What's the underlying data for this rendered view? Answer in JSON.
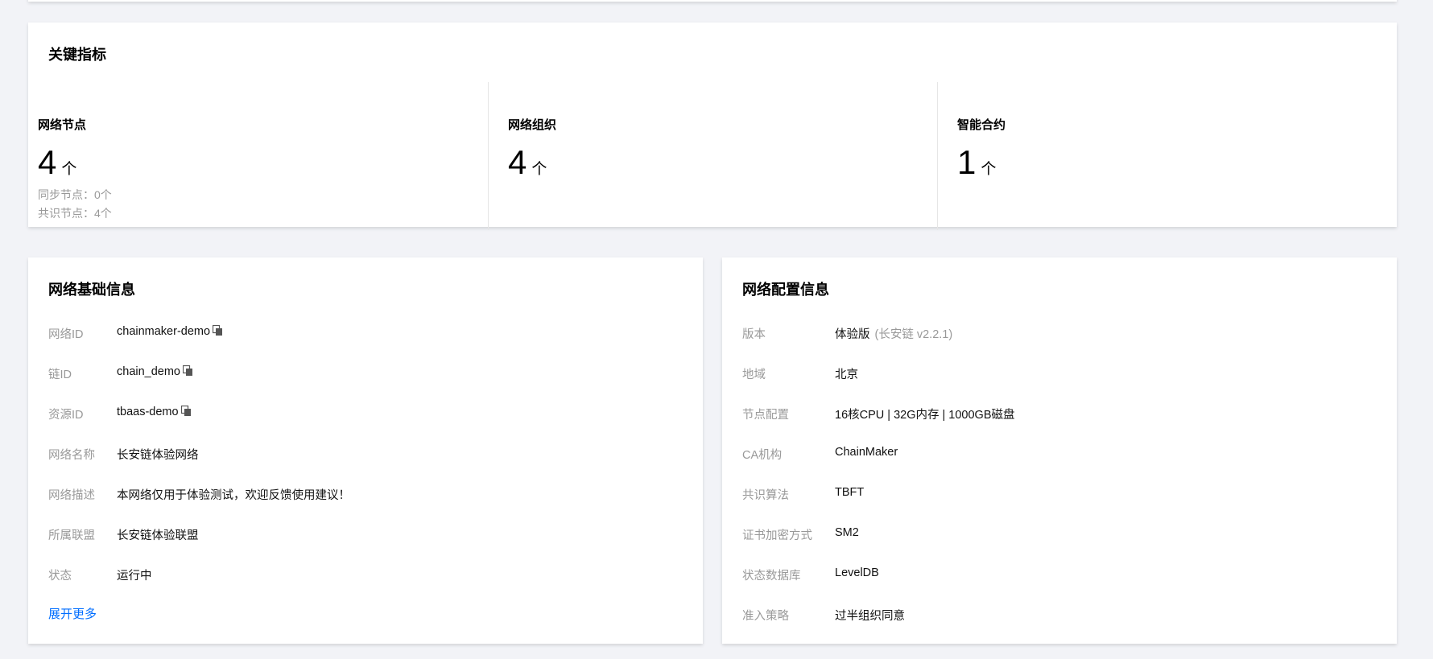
{
  "metrics": {
    "title": "关键指标",
    "items": [
      {
        "label": "网络节点",
        "value": "4",
        "unit": "个",
        "sub": [
          "同步节点：0个",
          "共识节点：4个"
        ]
      },
      {
        "label": "网络组织",
        "value": "4",
        "unit": "个"
      },
      {
        "label": "智能合约",
        "value": "1",
        "unit": "个"
      }
    ]
  },
  "basic": {
    "title": "网络基础信息",
    "rows": [
      {
        "key": "网络ID",
        "value": "chainmaker-demo"
      },
      {
        "key": "链ID",
        "value": "chain_demo"
      },
      {
        "key": "资源ID",
        "value": "tbaas-demo"
      },
      {
        "key": "网络名称",
        "value": "长安链体验网络"
      },
      {
        "key": "网络描述",
        "value": "本网络仅用于体验测试，欢迎反馈使用建议！"
      },
      {
        "key": "所属联盟",
        "value": "长安链体验联盟"
      },
      {
        "key": "状态",
        "value": "运行中"
      }
    ],
    "expand_label": "展开更多"
  },
  "config": {
    "title": "网络配置信息",
    "rows": [
      {
        "key": "版本",
        "value": "体验版",
        "note": "(长安链 v2.2.1)"
      },
      {
        "key": "地域",
        "value": "北京"
      },
      {
        "key": "节点配置",
        "value": "16核CPU | 32G内存 | 1000GB磁盘"
      },
      {
        "key": "CA机构",
        "value": "ChainMaker"
      },
      {
        "key": "共识算法",
        "value": "TBFT"
      },
      {
        "key": "证书加密方式",
        "value": "SM2"
      },
      {
        "key": "状态数据库",
        "value": "LevelDB"
      },
      {
        "key": "准入策略",
        "value": "过半组织同意"
      }
    ]
  },
  "colors": {
    "background": "#f2f3f7",
    "link": "#006eff",
    "muted": "#999999"
  },
  "icons": {
    "copy": "copy-icon"
  }
}
